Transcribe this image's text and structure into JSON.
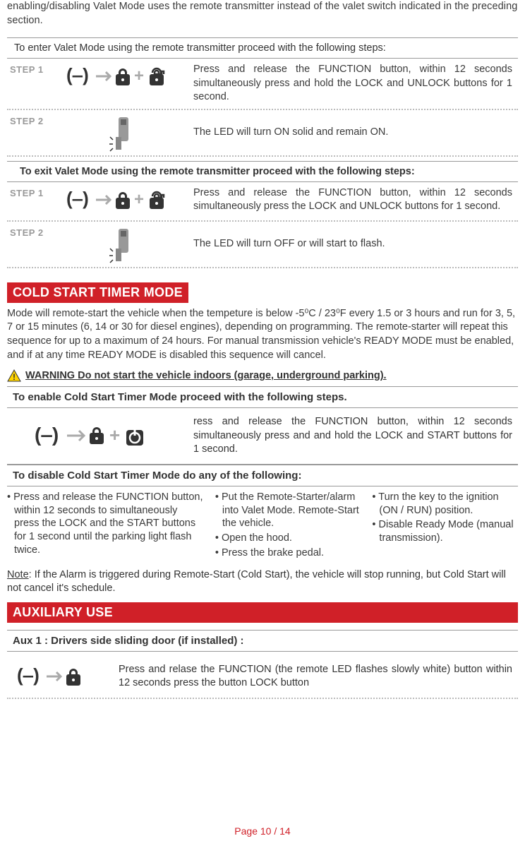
{
  "intro": "enabling/disabling Valet Mode uses the remote transmitter instead of the valet switch indicated in the preceding section.",
  "enter": {
    "header": "To enter Valet Mode using the remote transmitter proceed with the following steps:",
    "step1_label": "STEP 1",
    "step1_text": "Press and release the FUNCTION button, within 12 seconds simultaneously press and hold the LOCK and UNLOCK buttons for 1 second.",
    "step2_label": "STEP 2",
    "step2_text": "The LED will turn ON solid and remain ON."
  },
  "exit": {
    "header": "To exit Valet Mode using the remote transmitter proceed with the following steps:",
    "step1_label": "STEP 1",
    "step1_text": "Press and release the FUNCTION button, within 12 seconds simultaneously press the LOCK and UNLOCK buttons for 1 second.",
    "step2_label": "STEP 2",
    "step2_text": "The LED will turn OFF or will start to flash."
  },
  "cold": {
    "title": "COLD START TIMER MODE",
    "body": "Mode will remote-start the vehicle when the tempeture is below -5⁰C / 23⁰F every 1.5 or 3 hours and run for 3, 5, 7 or 15 minutes (6, 14 or 30 for diesel engines), depending on programming. The remote-starter will repeat this sequence for up to a maximum of 24 hours. For manual transmission vehicle's READY MODE must be enabled, and if at any time READY MODE is disabled this sequence will cancel.",
    "warning": "WARNING Do not start the vehicle indoors (garage, underground parking).",
    "enable_header": "To enable Cold Start Timer Mode proceed with the following steps.",
    "enable_text": "ress and release the FUNCTION button, within 12 seconds simultaneously press and and hold the LOCK and START buttons for 1 second.",
    "disable_header": "To disable Cold Start Timer Mode do any of the following:",
    "disable_col1_a": "Press and release the FUNCTION button, within 12 seconds to simultaneously press the LOCK and the START buttons for 1 second until the parking light flash twice.",
    "disable_col2_a": "Put the Remote-Starter/alarm into Valet Mode. Remote-Start the vehicle.",
    "disable_col2_b": "Open the hood.",
    "disable_col2_c": "Press the brake pedal.",
    "disable_col3_a": "Turn the key to the ignition (ON / RUN) position.",
    "disable_col3_b": "Disable Ready Mode (manual transmission).",
    "note_label": "Note",
    "note_body": ": If the Alarm is triggered during Remote-Start (Cold Start), the vehicle will stop running, but Cold Start will not cancel it's schedule."
  },
  "aux": {
    "title": "AUXILIARY USE",
    "sub": "Aux 1 : Drivers side sliding door (if installed) :",
    "text": "Press and relase the FUNCTION (the remote LED flashes slowly white) button within 12 seconds press the button LOCK button"
  },
  "footer": "Page 10 / 14"
}
